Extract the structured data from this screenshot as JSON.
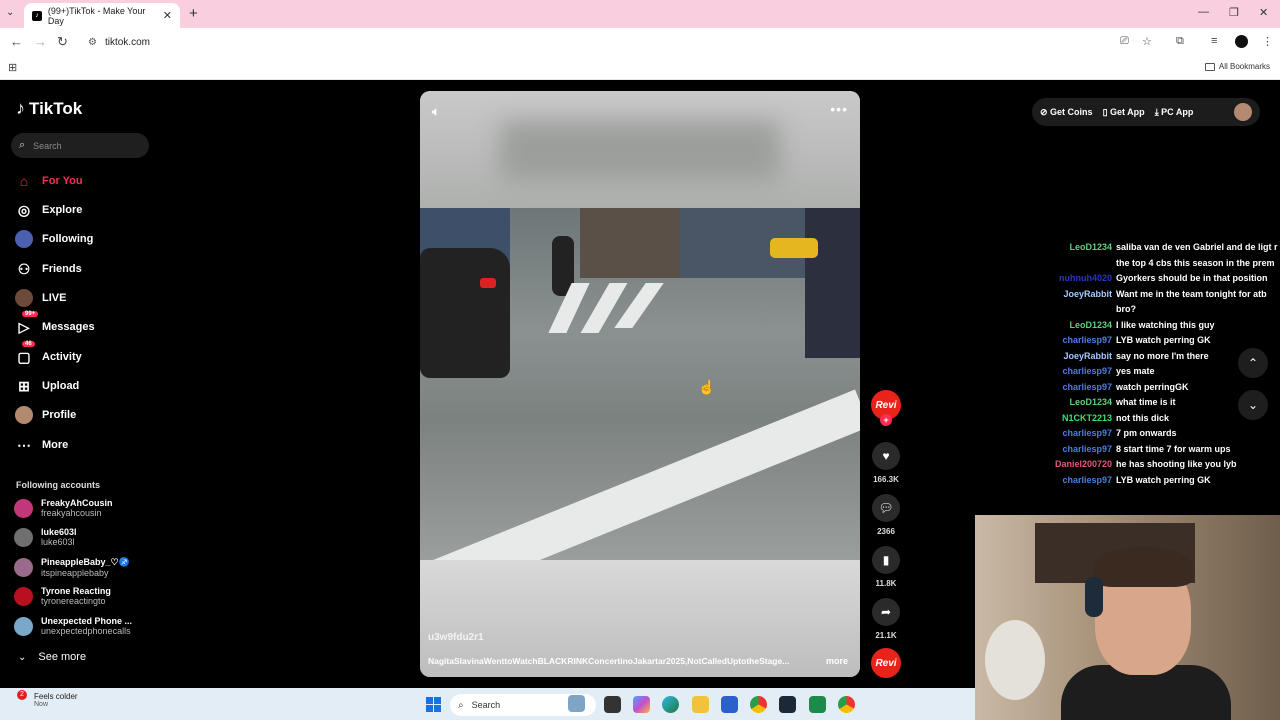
{
  "browser": {
    "tab_title": "(99+)TikTok - Make Your Day",
    "url": "tiktok.com",
    "all_bookmarks": "All Bookmarks"
  },
  "tiktok": {
    "logo": "TikTok",
    "search_placeholder": "Search",
    "nav": [
      {
        "label": "For You",
        "icon": "home-icon"
      },
      {
        "label": "Explore",
        "icon": "compass-icon"
      },
      {
        "label": "Following",
        "icon": "following-avatar-icon"
      },
      {
        "label": "Friends",
        "icon": "friends-icon"
      },
      {
        "label": "LIVE",
        "icon": "live-avatar-icon"
      },
      {
        "label": "Messages",
        "icon": "messages-icon",
        "badge": "99+"
      },
      {
        "label": "Activity",
        "icon": "activity-icon",
        "badge": "46"
      },
      {
        "label": "Upload",
        "icon": "upload-icon"
      },
      {
        "label": "Profile",
        "icon": "profile-avatar-icon"
      },
      {
        "label": "More",
        "icon": "more-dots-icon"
      }
    ],
    "following_title": "Following accounts",
    "accounts": [
      {
        "name": "FreakyAhCousin",
        "handle": "freakyahcousin",
        "color": "#c0387a"
      },
      {
        "name": "luke603l",
        "handle": "luke603l",
        "color": "#6f6f6f"
      },
      {
        "name": "PineappleBaby_♡♐",
        "handle": "itspineapplebaby",
        "color": "#9a6a8a"
      },
      {
        "name": "Tyrone Reacting",
        "handle": "tyronereactingto",
        "color": "#b81020"
      },
      {
        "name": "Unexpected Phone ...",
        "handle": "unexpectedphonecalls",
        "color": "#7aa8c8"
      }
    ],
    "see_more": "See more",
    "video": {
      "author": "u3w9fdu2r1",
      "caption": "NagitaSlavinaWenttoWatchBLACKRINKConcertinoJakartar2025,NotCalledUptotheStage...",
      "more": "more"
    },
    "actions": {
      "likes": "166.3K",
      "comments": "2366",
      "saves": "11.8K",
      "shares": "21.1K",
      "creator_badge": "Revi"
    },
    "topright": {
      "coins": "Get Coins",
      "app": "Get App",
      "pc_app": "PC App"
    }
  },
  "chat": [
    {
      "user": "LeoD1234",
      "text": "saliba van de ven Gabriel and de ligt r the top 4 cbs this season in the prem",
      "color": "#5fd07a"
    },
    {
      "user": "nuhnuh4020",
      "text": "Gyorkers should be in that position",
      "color": "#2a35c8"
    },
    {
      "user": "JoeyRabbit",
      "text": "Want me in the team tonight for atb bro?",
      "color": "#a8c8ff"
    },
    {
      "user": "LeoD1234",
      "text": "I like watching this guy",
      "color": "#5fd07a"
    },
    {
      "user": "charliesp97",
      "text": "LYB watch perring GK",
      "color": "#4a7ee0"
    },
    {
      "user": "JoeyRabbit",
      "text": "say no more I'm there",
      "color": "#a8c8ff"
    },
    {
      "user": "charliesp97",
      "text": "yes mate",
      "color": "#4a7ee0"
    },
    {
      "user": "charliesp97",
      "text": "watch perringGK",
      "color": "#4a7ee0"
    },
    {
      "user": "LeoD1234",
      "text": "what time is it",
      "color": "#5fd07a"
    },
    {
      "user": "N1CKT2213",
      "text": "not this dick",
      "color": "#3ce070"
    },
    {
      "user": "charliesp97",
      "text": "7 pm onwards",
      "color": "#4a7ee0"
    },
    {
      "user": "charliesp97",
      "text": "8 start time 7 for warm ups",
      "color": "#4a7ee0"
    },
    {
      "user": "Daniel200720",
      "text": "he has shooting like you lyb",
      "color": "#e05a7a"
    },
    {
      "user": "charliesp97",
      "text": "LYB watch perring GK",
      "color": "#4a7ee0"
    }
  ],
  "taskbar": {
    "weather_badge": "2",
    "weather_text": "Feels colder",
    "weather_sub": "Now",
    "search": "Search"
  }
}
